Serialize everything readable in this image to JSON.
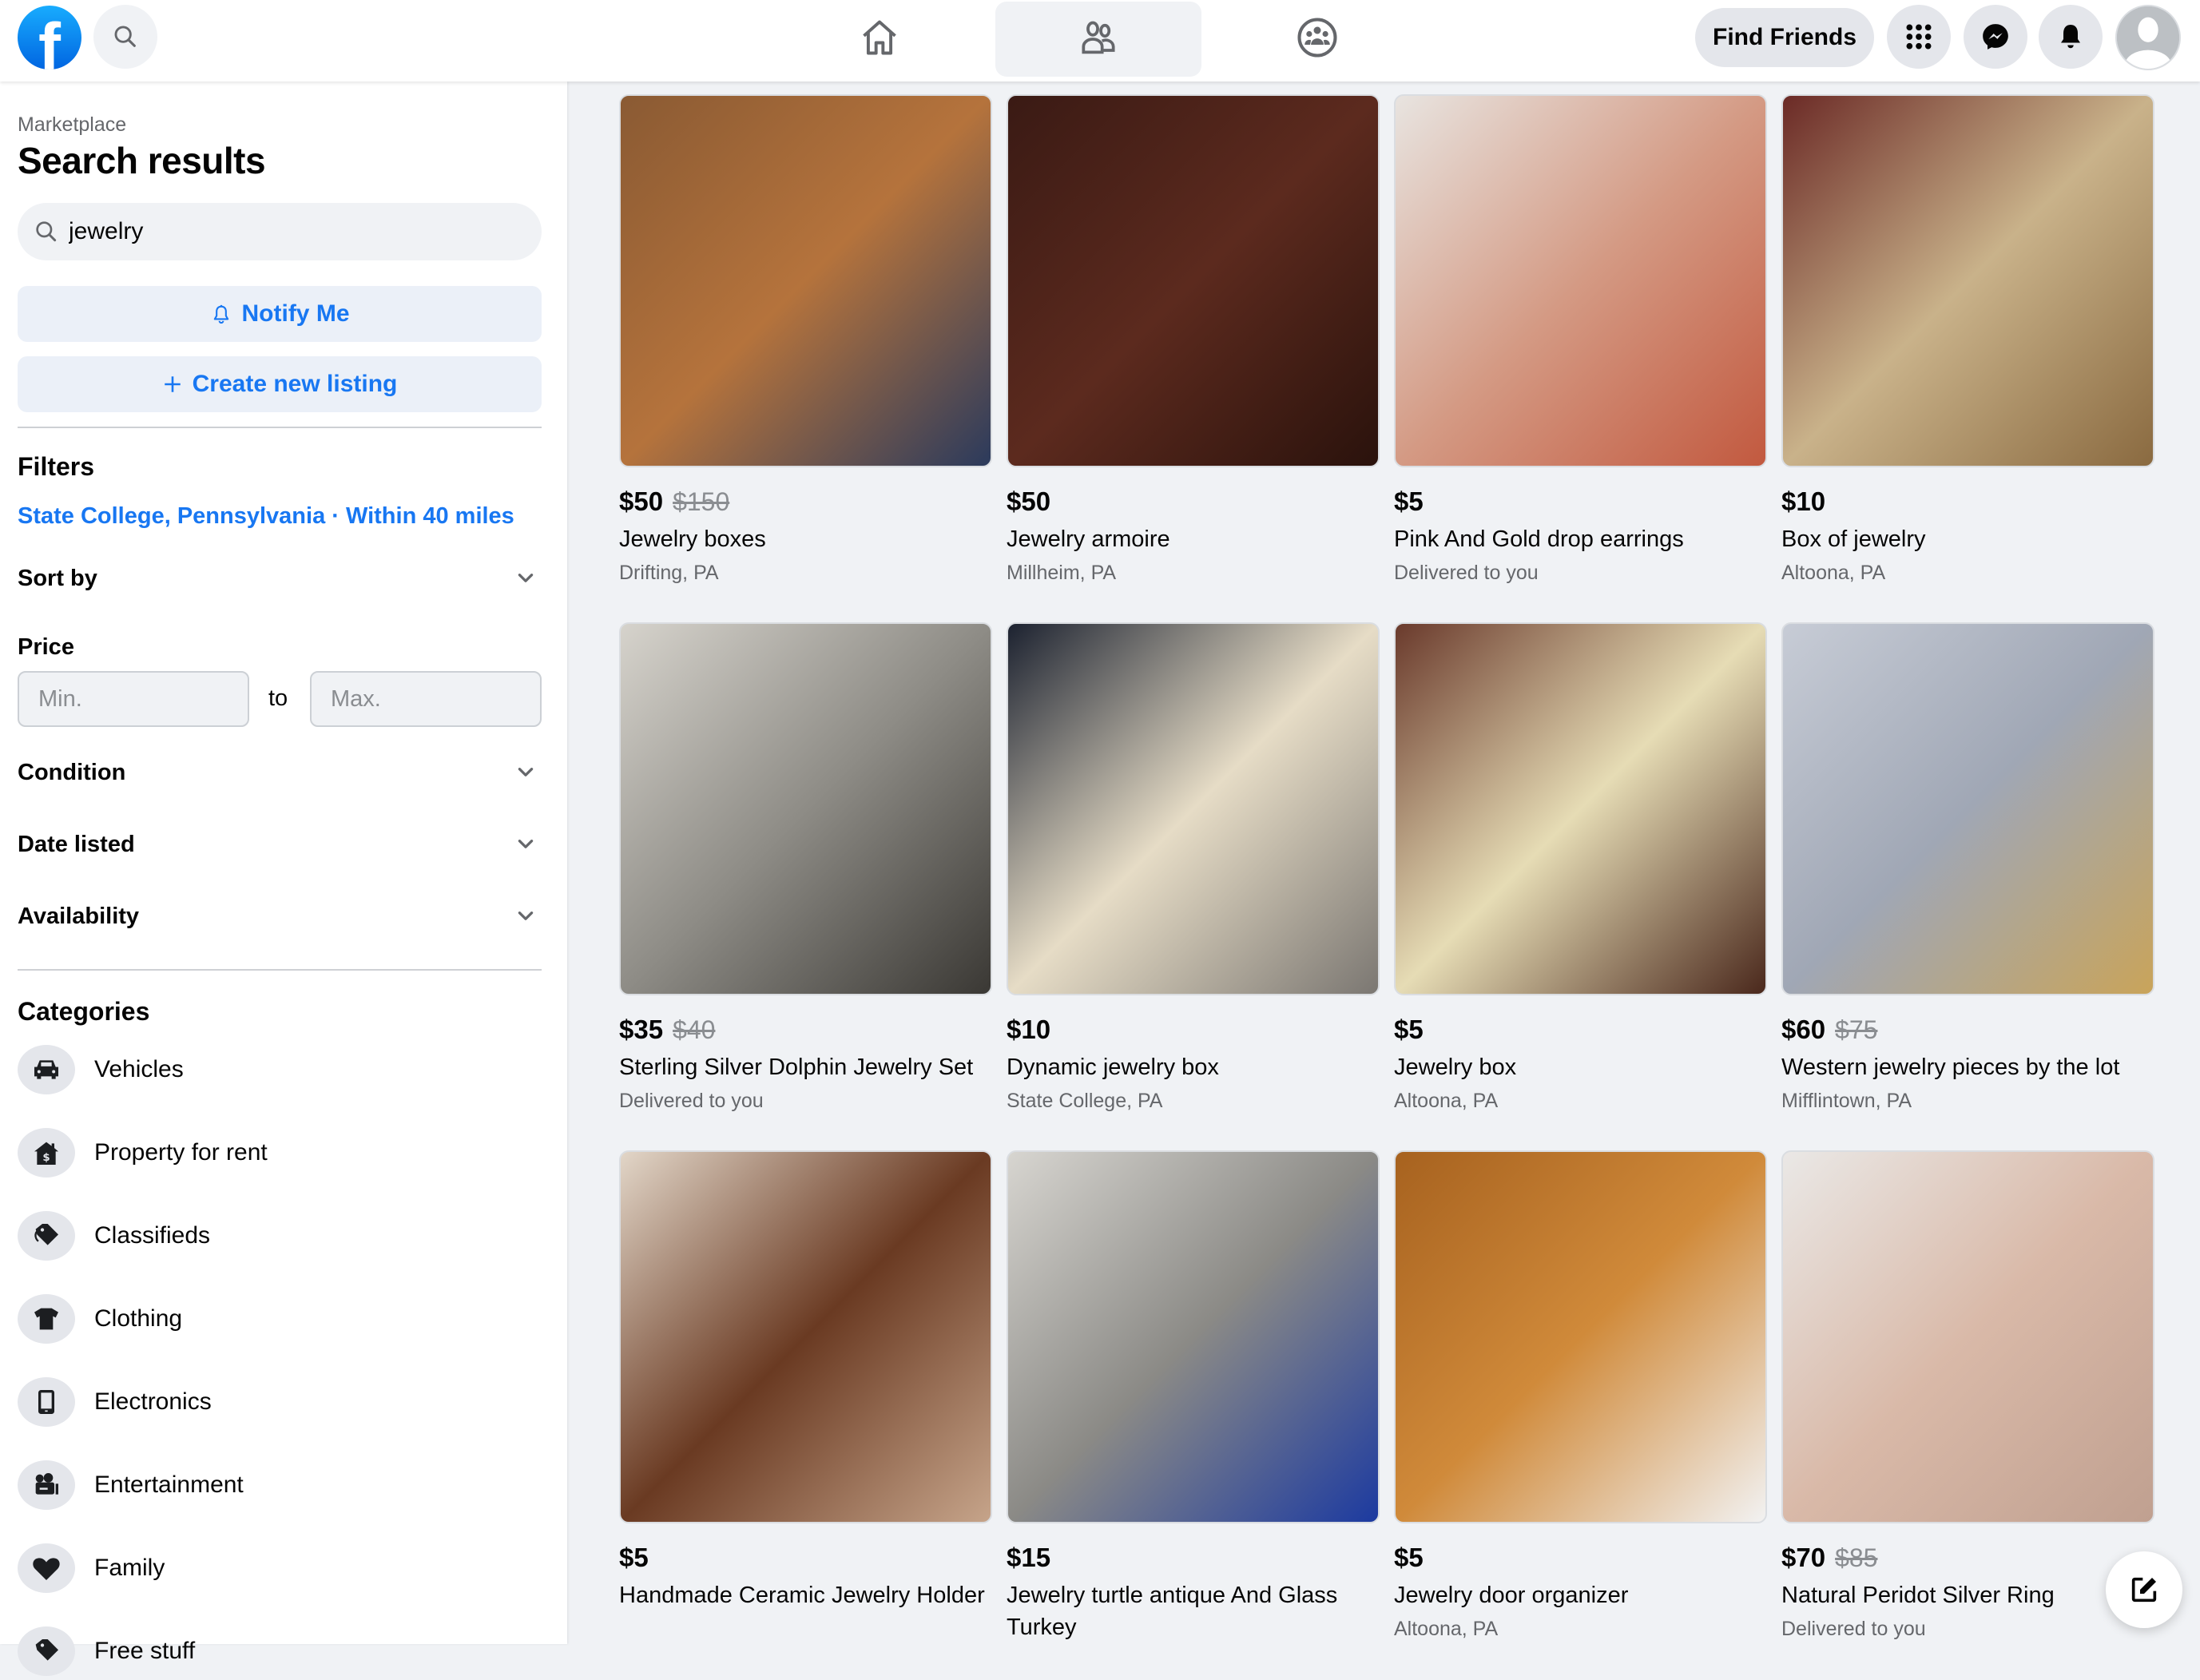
{
  "header": {
    "logo": "facebook-logo",
    "search_icon": "search-icon",
    "nav_tabs": [
      {
        "name": "home",
        "icon": "home-icon",
        "active": false
      },
      {
        "name": "friends",
        "icon": "friends-icon",
        "active": true
      },
      {
        "name": "groups",
        "icon": "groups-icon",
        "active": false
      }
    ],
    "find_friends_label": "Find Friends",
    "menu_icon": "grid-menu-icon",
    "messenger_icon": "messenger-icon",
    "notifications_icon": "bell-icon",
    "avatar_icon": "default-avatar-icon"
  },
  "sidebar": {
    "breadcrumb": "Marketplace",
    "title": "Search results",
    "search": {
      "value": "jewelry",
      "icon": "search-icon"
    },
    "notify_label": "Notify Me",
    "create_label": "Create new listing",
    "filters_title": "Filters",
    "location": "State College, Pennsylvania · Within 40 miles",
    "sort_by": "Sort by",
    "price_label": "Price",
    "price_min_placeholder": "Min.",
    "price_max_placeholder": "Max.",
    "price_to": "to",
    "condition": "Condition",
    "date_listed": "Date listed",
    "availability": "Availability",
    "categories_title": "Categories",
    "categories": [
      {
        "label": "Vehicles",
        "icon": "car-icon"
      },
      {
        "label": "Property for rent",
        "icon": "house-dollar-icon"
      },
      {
        "label": "Classifieds",
        "icon": "tag-icon"
      },
      {
        "label": "Clothing",
        "icon": "shirt-icon"
      },
      {
        "label": "Electronics",
        "icon": "tablet-icon"
      },
      {
        "label": "Entertainment",
        "icon": "video-camera-icon"
      },
      {
        "label": "Family",
        "icon": "heart-icon"
      },
      {
        "label": "Free stuff",
        "icon": "tag-icon"
      }
    ]
  },
  "listings": [
    {
      "price": "$50",
      "old_price": "$150",
      "title": "Jewelry boxes",
      "location": "Drifting, PA",
      "colors": [
        "#8a5a33",
        "#b5733c",
        "#2b3a5c"
      ]
    },
    {
      "price": "$50",
      "old_price": "",
      "title": "Jewelry armoire",
      "location": "Millheim, PA",
      "colors": [
        "#3a1a14",
        "#5c2a1e",
        "#2a120c"
      ]
    },
    {
      "price": "$5",
      "old_price": "",
      "title": "Pink And Gold drop earrings",
      "location": "Delivered to you",
      "colors": [
        "#e8e4e0",
        "#d49a84",
        "#c2593f"
      ]
    },
    {
      "price": "$10",
      "old_price": "",
      "title": "Box of jewelry",
      "location": "Altoona, PA",
      "colors": [
        "#6b2a26",
        "#c9b28a",
        "#8a6a40"
      ]
    },
    {
      "price": "$35",
      "old_price": "$40",
      "title": "Sterling Silver Dolphin Jewelry Set",
      "location": "Delivered to you",
      "colors": [
        "#d6d3cc",
        "#8e8c86",
        "#3a3834"
      ]
    },
    {
      "price": "$10",
      "old_price": "",
      "title": "Dynamic jewelry box",
      "location": "State College, PA",
      "colors": [
        "#1c2230",
        "#e6dcc6",
        "#7b7772"
      ]
    },
    {
      "price": "$5",
      "old_price": "",
      "title": "Jewelry box",
      "location": "Altoona, PA",
      "colors": [
        "#6a3a2c",
        "#e6dcb5",
        "#4a281c"
      ]
    },
    {
      "price": "$60",
      "old_price": "$75",
      "title": "Western jewelry pieces by the lot",
      "location": "Mifflintown, PA",
      "colors": [
        "#c7ccd6",
        "#a0a7b5",
        "#c9a45a"
      ]
    },
    {
      "price": "$5",
      "old_price": "",
      "title": "Handmade Ceramic Jewelry Holder",
      "location": "",
      "colors": [
        "#e2d6c8",
        "#6a3a22",
        "#c6a48a"
      ]
    },
    {
      "price": "$15",
      "old_price": "",
      "title": "Jewelry turtle antique And Glass Turkey",
      "location": "",
      "colors": [
        "#d7d5d0",
        "#8b8a86",
        "#1c3aa0"
      ]
    },
    {
      "price": "$5",
      "old_price": "",
      "title": "Jewelry door organizer",
      "location": "Altoona, PA",
      "colors": [
        "#a7621f",
        "#d08a3a",
        "#f2f2f2"
      ]
    },
    {
      "price": "$70",
      "old_price": "$85",
      "title": "Natural Peridot Silver Ring",
      "location": "Delivered to you",
      "colors": [
        "#eae8e6",
        "#d9b9a8",
        "#c0a090"
      ]
    }
  ],
  "fab_icon": "compose-icon"
}
